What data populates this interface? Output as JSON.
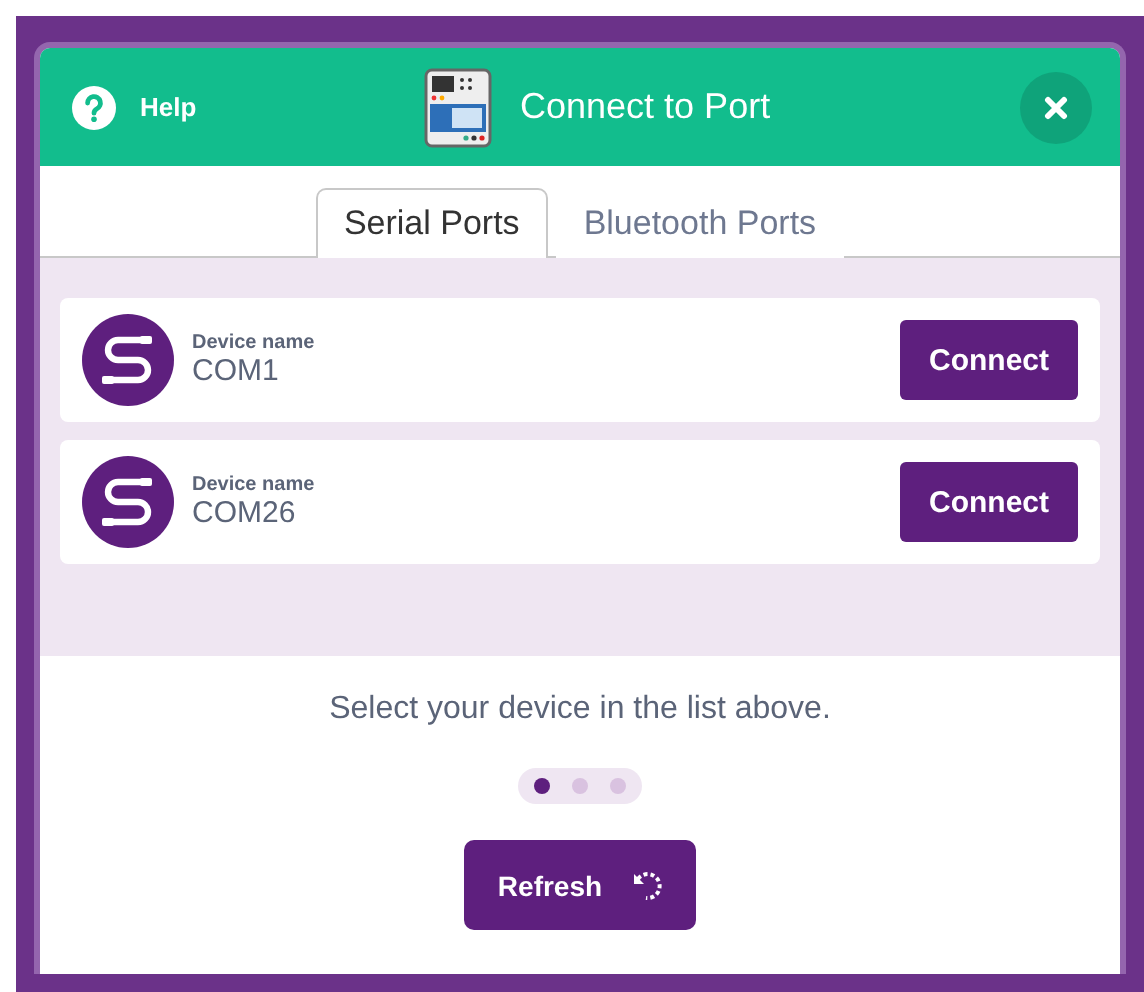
{
  "header": {
    "help": "Help",
    "title": "Connect to Port"
  },
  "tabs": [
    {
      "label": "Serial Ports",
      "selected": true
    },
    {
      "label": "Bluetooth Ports",
      "selected": false
    }
  ],
  "devices": [
    {
      "caption": "Device name",
      "name": "COM1",
      "button": "Connect"
    },
    {
      "caption": "Device name",
      "name": "COM26",
      "button": "Connect"
    }
  ],
  "instruction": "Select your device in the list above.",
  "steps": [
    {
      "selected": true
    },
    {
      "selected": false
    },
    {
      "selected": false
    }
  ],
  "refresh_button": "Refresh"
}
